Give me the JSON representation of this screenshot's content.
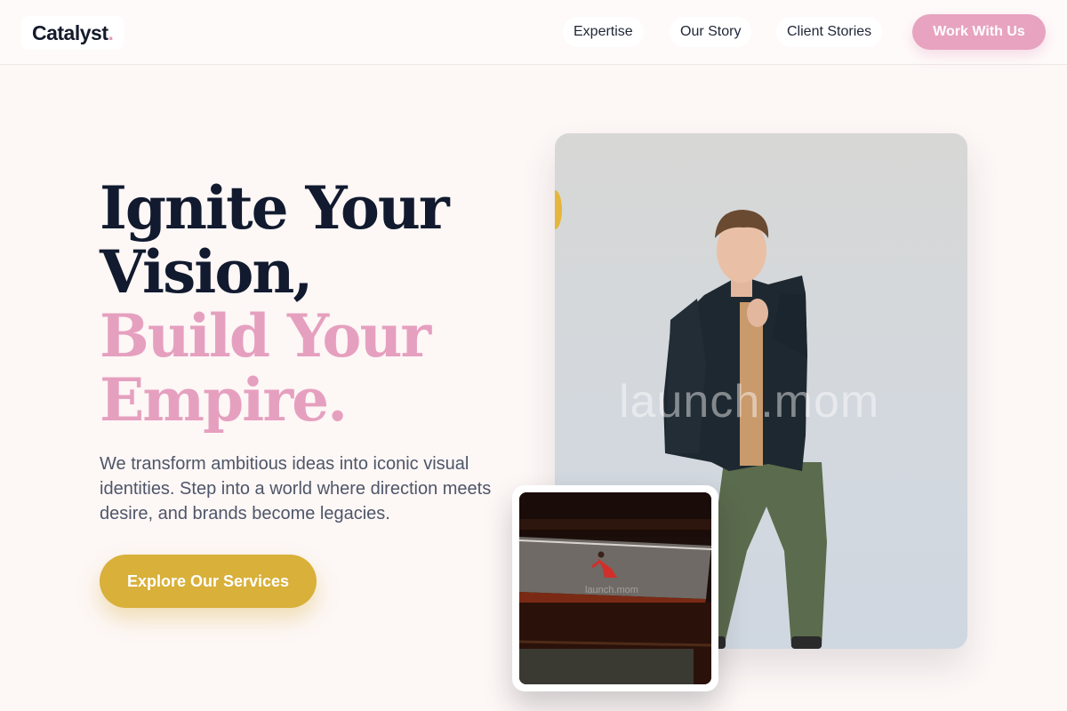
{
  "header": {
    "logo_text": "Catalyst",
    "logo_dot": ".",
    "nav": [
      "Expertise",
      "Our Story",
      "Client Stories"
    ],
    "cta": "Work With Us"
  },
  "hero": {
    "headline_lines": [
      "Ignite Your",
      "Vision,",
      "Build Your",
      "Empire."
    ],
    "subtext": "We transform ambitious ideas into iconic visual identities. Step into a world where direction meets desire, and brands become legacies.",
    "cta": "Explore Our Services"
  },
  "media": {
    "main_photo_icon": "fashion-model-photo",
    "small_photo_icon": "red-dress-architecture-photo",
    "watermark_main": "launch.mom",
    "watermark_small": "launch.mom"
  },
  "colors": {
    "accent_pink": "#e6a0bf",
    "accent_gold": "#d8b03a",
    "heading_dark": "#111a2e",
    "background": "#fdf7f6"
  }
}
